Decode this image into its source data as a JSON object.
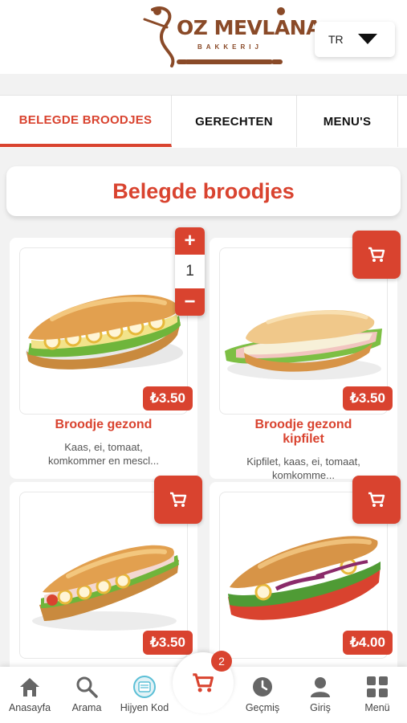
{
  "header": {
    "logo_text": "OZ MEVLANA",
    "logo_subtext": "BAKKERIJ",
    "language": "TR"
  },
  "tabs": [
    {
      "label": "BELEGDE BROODJES",
      "active": true
    },
    {
      "label": "GERECHTEN",
      "active": false
    },
    {
      "label": "MENU'S",
      "active": false
    }
  ],
  "section": {
    "title": "Belegde broodjes"
  },
  "products": [
    {
      "title": "Broodje gezond",
      "price": "₺3.50",
      "desc": "Kaas, ei, tomaat,",
      "desc2": "komkommer en mescl..."
    },
    {
      "title": "Broodje gezond",
      "title2": "kipfilet",
      "price": "₺3.50",
      "desc": "Kipfilet, kaas, ei, tomaat,",
      "desc2": "komkomme..."
    },
    {
      "title": "",
      "price": "₺3.50",
      "desc": "",
      "desc2": ""
    },
    {
      "title": "",
      "price": "₺4.00",
      "desc": "",
      "desc2": ""
    }
  ],
  "stepper": {
    "plus": "+",
    "value": "1",
    "minus": "−"
  },
  "bottom_nav": {
    "items": [
      {
        "label": "Anasayfa",
        "icon": "home-icon"
      },
      {
        "label": "Arama",
        "icon": "search-icon"
      },
      {
        "label": "Hijyen Kod",
        "icon": "hygiene-icon"
      },
      {
        "label": "Geçmiş",
        "icon": "history-icon"
      },
      {
        "label": "Giriş",
        "icon": "user-icon"
      },
      {
        "label": "Menü",
        "icon": "grid-icon"
      }
    ],
    "cart_count": "2"
  },
  "colors": {
    "accent": "#d9432f",
    "logo_brown": "#8a4a28",
    "background": "#f2f2f2"
  }
}
